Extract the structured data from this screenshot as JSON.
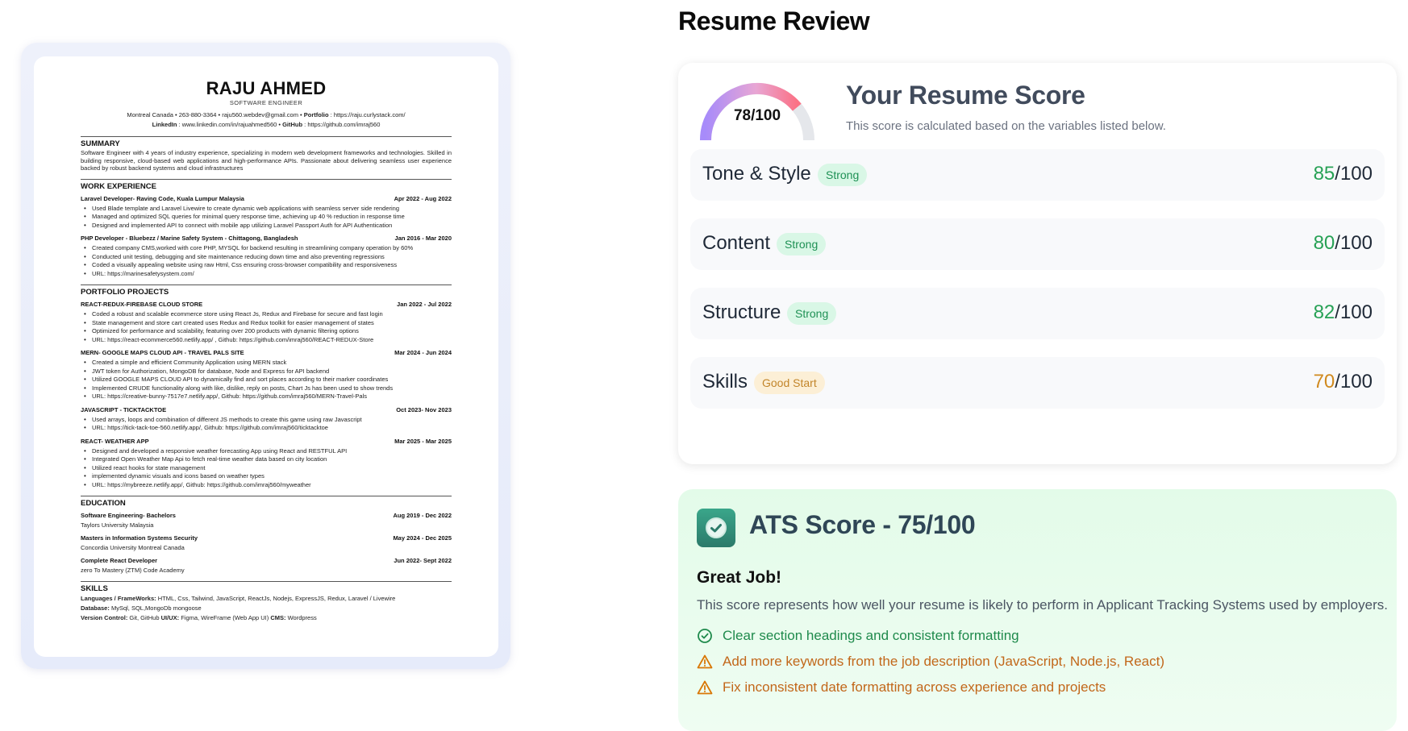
{
  "page": {
    "title": "Resume Review"
  },
  "resume": {
    "name": "RAJU AHMED",
    "role": "SOFTWARE ENGINEER",
    "contact_line1_plain": "Montreal Canada • 263-880-3364 • raju560.webdev@gmail.com • ",
    "contact_portfolio_label": "Portfolio",
    "contact_portfolio_value": " : https://raju.curlystack.com/",
    "contact_linkedin_label": "LinkedIn",
    "contact_linkedin_value": " : www.linkedin.com/in/rajuahmed560 • ",
    "contact_github_label": "GitHub",
    "contact_github_value": " : https://github.com/imraj560",
    "summary_heading": "SUMMARY",
    "summary_text": "Software Engineer with 4 years of industry experience, specializing in modern web development frameworks and technologies. Skilled in building responsive, cloud-based web applications and high-performance APIs. Passionate about delivering seamless user experience backed by robust backend systems and cloud infrastructures",
    "work_heading": "WORK EXPERIENCE",
    "jobs": [
      {
        "title": "Laravel Developer- Raving Code, Kuala Lumpur Malaysia",
        "dates": "Apr 2022 - Aug 2022",
        "bullets": [
          "Used Blade template and Laravel Livewire to create dynamic web applications with seamless server side rendering",
          "Managed and optimized SQL queries for minimal query response time, achieving up 40 % reduction in response time",
          "Designed and implemented API to connect with mobile app utilizing Laravel Passport Auth for API Authentication"
        ]
      },
      {
        "title": "PHP Developer - Bluebezz / Marine Safety System - Chittagong, Bangladesh",
        "dates": "Jan 2016 - Mar 2020",
        "bullets": [
          "Created company CMS,worked with core PHP, MYSQL for backend resulting in streamlining company operation by 60%",
          "Conducted unit testing, debugging and site maintenance reducing down time and also preventing regressions",
          "Coded a visually appealing website using raw Html, Css ensuring cross-browser compatibility and responsiveness",
          "URL: https://marinesafetysystem.com/"
        ]
      }
    ],
    "portfolio_heading": "PORTFOLIO PROJECTS",
    "projects": [
      {
        "title": "REACT-REDUX-FIREBASE CLOUD STORE",
        "dates": "Jan 2022 - Jul 2022",
        "bullets": [
          "Coded a robust and scalable ecommerce store using React Js, Redux and Firebase for secure and fast login",
          "State management and store cart created uses Redux and Redux toolkit for easier management of states",
          "Optimized for performance and scalability, featuring over 200 products with dynamic filtering options",
          "URL: https://react-ecommerce560.netlify.app/ , Github: https://github.com/imraj560/REACT-REDUX-Store"
        ]
      },
      {
        "title": "MERN- GOOGLE MAPS CLOUD API - TRAVEL PALS SITE",
        "dates": "Mar 2024 - Jun 2024",
        "bullets": [
          "Created a simple and efficient Community Application using MERN stack",
          "JWT token for Authorization, MongoDB for database, Node and Express for API backend",
          "Utilized GOOGLE MAPS CLOUD API to dynamically find and sort places according to their marker coordinates",
          "Implemented CRUDE functionality along with like, dislike, reply on posts, Chart Js has been used to show trends",
          "URL: https://creative-bunny-7517e7.netlify.app/, Github: https://github.com/imraj560/MERN-Travel-Pals"
        ]
      },
      {
        "title": "JAVASCRIPT - TICKTACKTOE",
        "dates": "Oct 2023- Nov 2023",
        "bullets": [
          "Used arrays, loops and combination of different JS methods to create this game using raw Javascript",
          "URL: https://tick-tack-toe-560.netlify.app/, Github: https://github.com/imraj560/ticktacktoe"
        ]
      },
      {
        "title": "REACT- WEATHER APP",
        "dates": "Mar 2025 - Mar 2025",
        "bullets": [
          "Designed and developed a responsive weather forecasting App using React and RESTFUL API",
          "Integrated Open Weather Map Api to fetch real-time weather data based on city location",
          "Utilized react hooks for state management",
          "implemented dynamic visuals and icons based on weather types",
          "URL: https://mybreeze.netlify.app/, Github: https://github.com/imraj560/myweather"
        ]
      }
    ],
    "education_heading": "EDUCATION",
    "education": [
      {
        "degree": "Software Engineering- Bachelors",
        "dates": "Aug 2019 - Dec 2022",
        "school": "Taylors University Malaysia"
      },
      {
        "degree": "Masters in Information Systems Security",
        "dates": "May 2024 - Dec 2025",
        "school": "Concordia University Montreal Canada"
      },
      {
        "degree": "Complete React Developer",
        "dates": "Jun 2022- Sept 2022",
        "school": "zero To Mastery (ZTM) Code Academy"
      }
    ],
    "skills_heading": "SKILLS",
    "skills": [
      {
        "label": "Languages / FrameWorks:",
        "value": " HTML, Css, Tailwind, JavaScript, ReactJs, Nodejs, ExpressJS, Redux, Laravel / Livewire"
      },
      {
        "label": "Database:",
        "value": " MySql, SQL,MongoDb mongoose"
      },
      {
        "label": "Version Control:",
        "value": " Git, GitHub ",
        "label2": "UI/UX:",
        "value2": " Figma, WireFrame (Web App UI) ",
        "label3": "CMS:",
        "value3": " Wordpress"
      }
    ]
  },
  "score_card": {
    "gauge_text": "78/100",
    "gauge_value": 78,
    "gauge_max": 100,
    "title": "Your Resume Score",
    "subtitle": "This score is calculated based on the variables listed below.",
    "categories": [
      {
        "label": "Tone & Style",
        "badge": "Strong",
        "score": "85",
        "max": "/100",
        "tone": "strong"
      },
      {
        "label": "Content",
        "badge": "Strong",
        "score": "80",
        "max": "/100",
        "tone": "strong"
      },
      {
        "label": "Structure",
        "badge": "Strong",
        "score": "82",
        "max": "/100",
        "tone": "strong"
      },
      {
        "label": "Skills",
        "badge": "Good Start",
        "score": "70",
        "max": "/100",
        "tone": "good"
      }
    ]
  },
  "ats": {
    "title": "ATS Score - 75/100",
    "headline": "Great Job!",
    "description": "This score represents how well your resume is likely to perform in Applicant Tracking Systems used by employers.",
    "items": [
      {
        "text": "Clear section headings and consistent formatting",
        "type": "ok",
        "icon": "check-circle-icon"
      },
      {
        "text": "Add more keywords from the job description (JavaScript, Node.js, React)",
        "type": "warn",
        "icon": "warning-icon"
      },
      {
        "text": "Fix inconsistent date formatting across experience and projects",
        "type": "warn",
        "icon": "warning-icon"
      }
    ]
  },
  "colors": {
    "strong_green": "#27a155",
    "good_orange": "#d08a1f",
    "ats_bg": "#e3fbe9"
  }
}
